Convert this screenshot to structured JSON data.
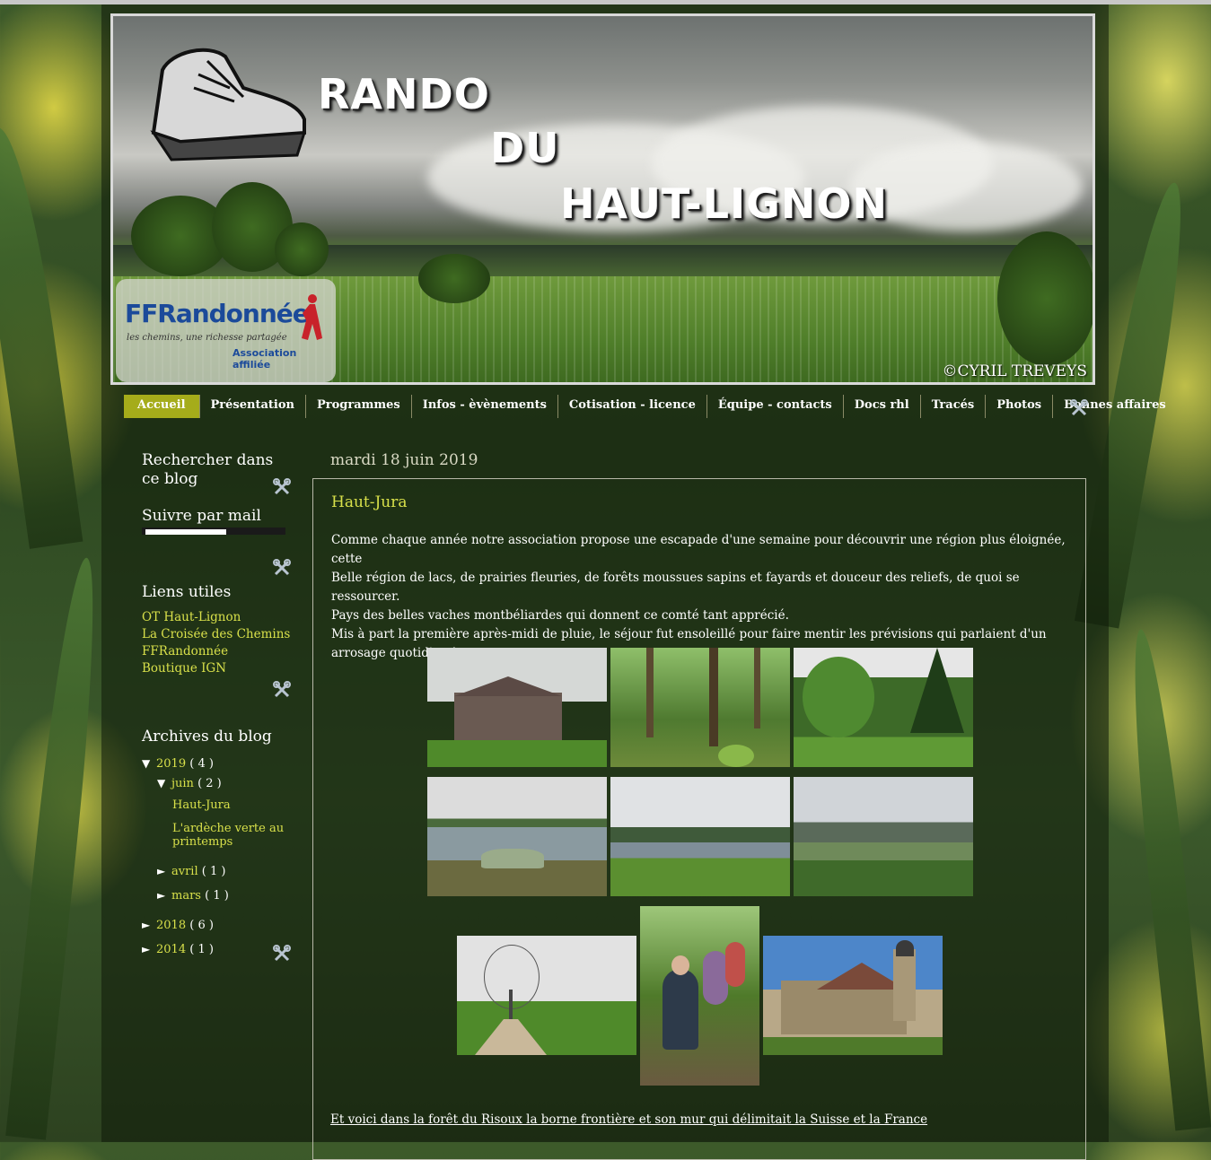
{
  "header": {
    "title_line1": "RANDO",
    "title_line2": "DU",
    "title_line3": "HAUT-LIGNON",
    "copyright": "©CYRIL TREVEYS",
    "ffr_name": "FFRandonnée",
    "ffr_tagline": "les chemins, une richesse partagée",
    "ffr_affiliation": "Association affiliée"
  },
  "nav": {
    "items": [
      {
        "label": "Accueil",
        "active": true
      },
      {
        "label": "Présentation"
      },
      {
        "label": "Programmes"
      },
      {
        "label": "Infos - èvènements"
      },
      {
        "label": "Cotisation - licence"
      },
      {
        "label": "Équipe - contacts"
      },
      {
        "label": "Docs rhl"
      },
      {
        "label": "Tracés"
      },
      {
        "label": "Photos"
      },
      {
        "label": "Bonnes affaires"
      }
    ]
  },
  "sidebar": {
    "search_title": "Rechercher dans ce blog",
    "follow_title": "Suivre par mail",
    "links_title": "Liens utiles",
    "links": [
      "OT Haut-Lignon",
      "La Croisée des Chemins",
      "FFRandonnée",
      "Boutique IGN"
    ],
    "archive_title": "Archives du blog",
    "archive": {
      "y2019": {
        "label": "2019",
        "count": "( 4 )"
      },
      "juin": {
        "label": "juin",
        "count": "( 2 )"
      },
      "post1": "Haut-Jura",
      "post2": "L'ardèche verte au printemps",
      "avril": {
        "label": "avril",
        "count": "( 1 )"
      },
      "mars": {
        "label": "mars",
        "count": "( 1 )"
      },
      "y2018": {
        "label": "2018",
        "count": "( 6 )"
      },
      "y2014": {
        "label": "2014",
        "count": "( 1 )"
      }
    }
  },
  "post": {
    "date": "mardi 18 juin 2019",
    "title": "Haut-Jura",
    "p1": "Comme chaque année notre association propose une escapade d'une semaine pour découvrir une région plus éloignée, cette",
    "p2": "Belle région de lacs, de prairies fleuries, de forêts moussues sapins et fayards et douceur des reliefs, de quoi se ressourcer.",
    "p3": "Pays des belles vaches montbéliardes qui donnent ce comté tant apprécié.",
    "p4": "Mis à part la première après-midi de pluie, le séjour fut ensoleillé pour faire mentir les prévisions qui parlaient d'un arrosage quotidien !",
    "footnote": "Et voici dans la forêt du Risoux la borne frontière et son mur qui délimitait la Suisse et la France"
  },
  "colors": {
    "accent": "#a5ac1a",
    "link": "#d8e04a",
    "text": "#ffffff"
  },
  "icons": [
    "boot-logo-icon",
    "hiker-icon",
    "wrench-icon",
    "triangle-down-icon",
    "triangle-right-icon"
  ]
}
